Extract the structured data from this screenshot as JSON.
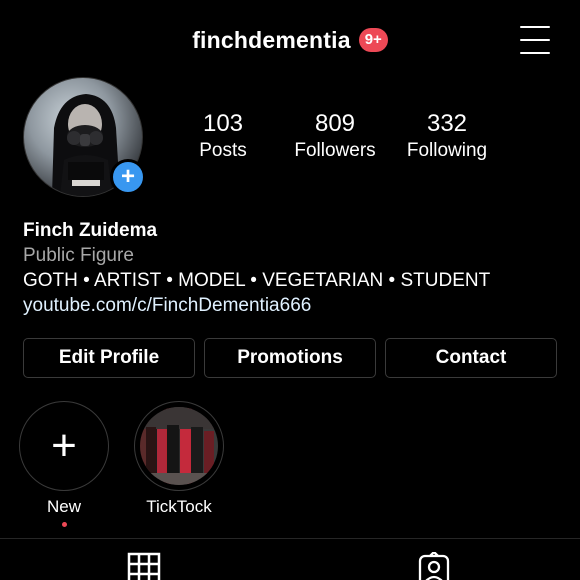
{
  "header": {
    "username": "finchdementia",
    "notification_badge": "9+",
    "menu_icon": "hamburger-menu-icon"
  },
  "profile": {
    "avatar_icon": "profile-photo",
    "add_story_icon": "plus-icon",
    "add_story_glyph": "+"
  },
  "stats": [
    {
      "value": "103",
      "label": "Posts"
    },
    {
      "value": "809",
      "label": "Followers"
    },
    {
      "value": "332",
      "label": "Following"
    }
  ],
  "bio": {
    "name": "Finch Zuidema",
    "category": "Public Figure",
    "description": "GOTH • ARTIST • MODEL • VEGETARIAN • STUDENT",
    "link": "youtube.com/c/FinchDementia666"
  },
  "buttons": {
    "edit_profile": "Edit Profile",
    "promotions": "Promotions",
    "contact": "Contact"
  },
  "highlights": [
    {
      "label": "New",
      "icon": "plus-icon",
      "glyph": "+",
      "has_dot": true
    },
    {
      "label": "TickTock",
      "icon": "highlight-thumbnail",
      "has_dot": false
    }
  ],
  "tabs": [
    {
      "name": "grid-icon",
      "active": true
    },
    {
      "name": "tagged-icon",
      "active": false
    }
  ],
  "colors": {
    "background": "#000000",
    "badge": "#ed4956",
    "add_story": "#3897f0",
    "secondary_text": "#a8a8a8",
    "link": "#e0f1ff"
  }
}
